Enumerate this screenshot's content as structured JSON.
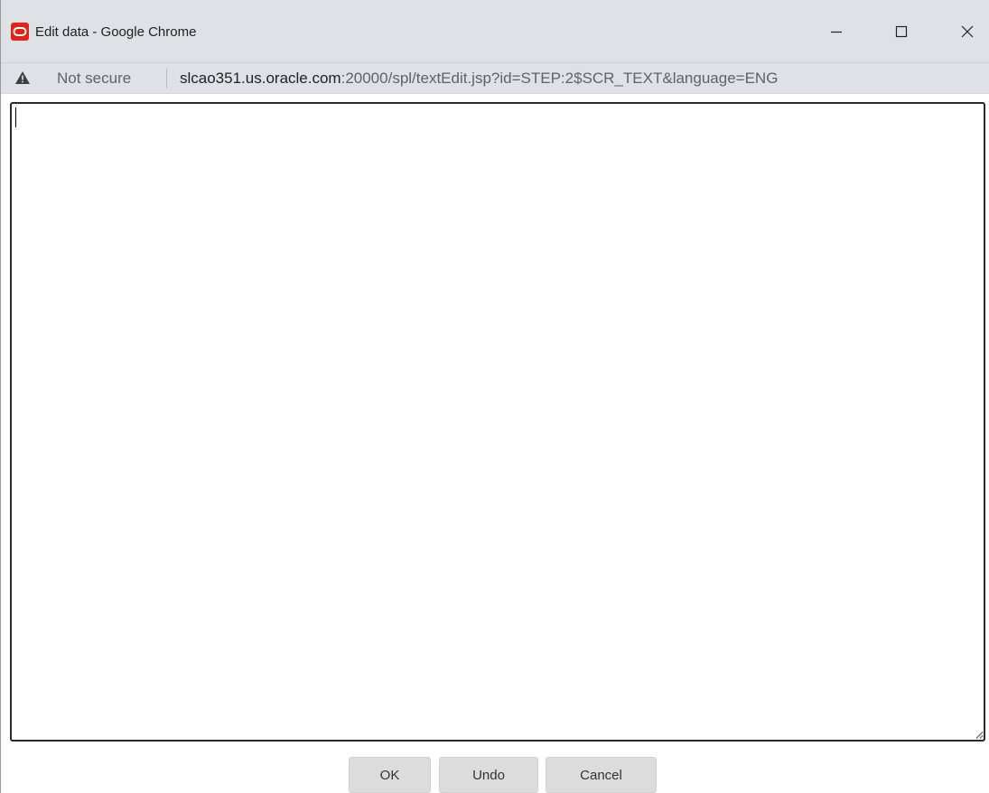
{
  "window": {
    "title": "Edit data - Google Chrome",
    "app_icon": "oracle-logo-icon",
    "controls": {
      "minimize_icon": "minimize-icon",
      "maximize_icon": "maximize-icon",
      "close_icon": "close-icon"
    }
  },
  "addressbar": {
    "security_icon": "warning-icon",
    "security_text": "Not secure",
    "url_host": "slcao351.us.oracle.com",
    "url_path": ":20000/spl/textEdit.jsp?id=STEP:2$SCR_TEXT&language=ENG"
  },
  "editor": {
    "value": ""
  },
  "buttons": {
    "ok": "OK",
    "undo": "Undo",
    "cancel": "Cancel"
  },
  "colors": {
    "chrome_frame": "#dee1e6",
    "oracle_red": "#e2231a",
    "button_bg": "#dcdcdc"
  }
}
